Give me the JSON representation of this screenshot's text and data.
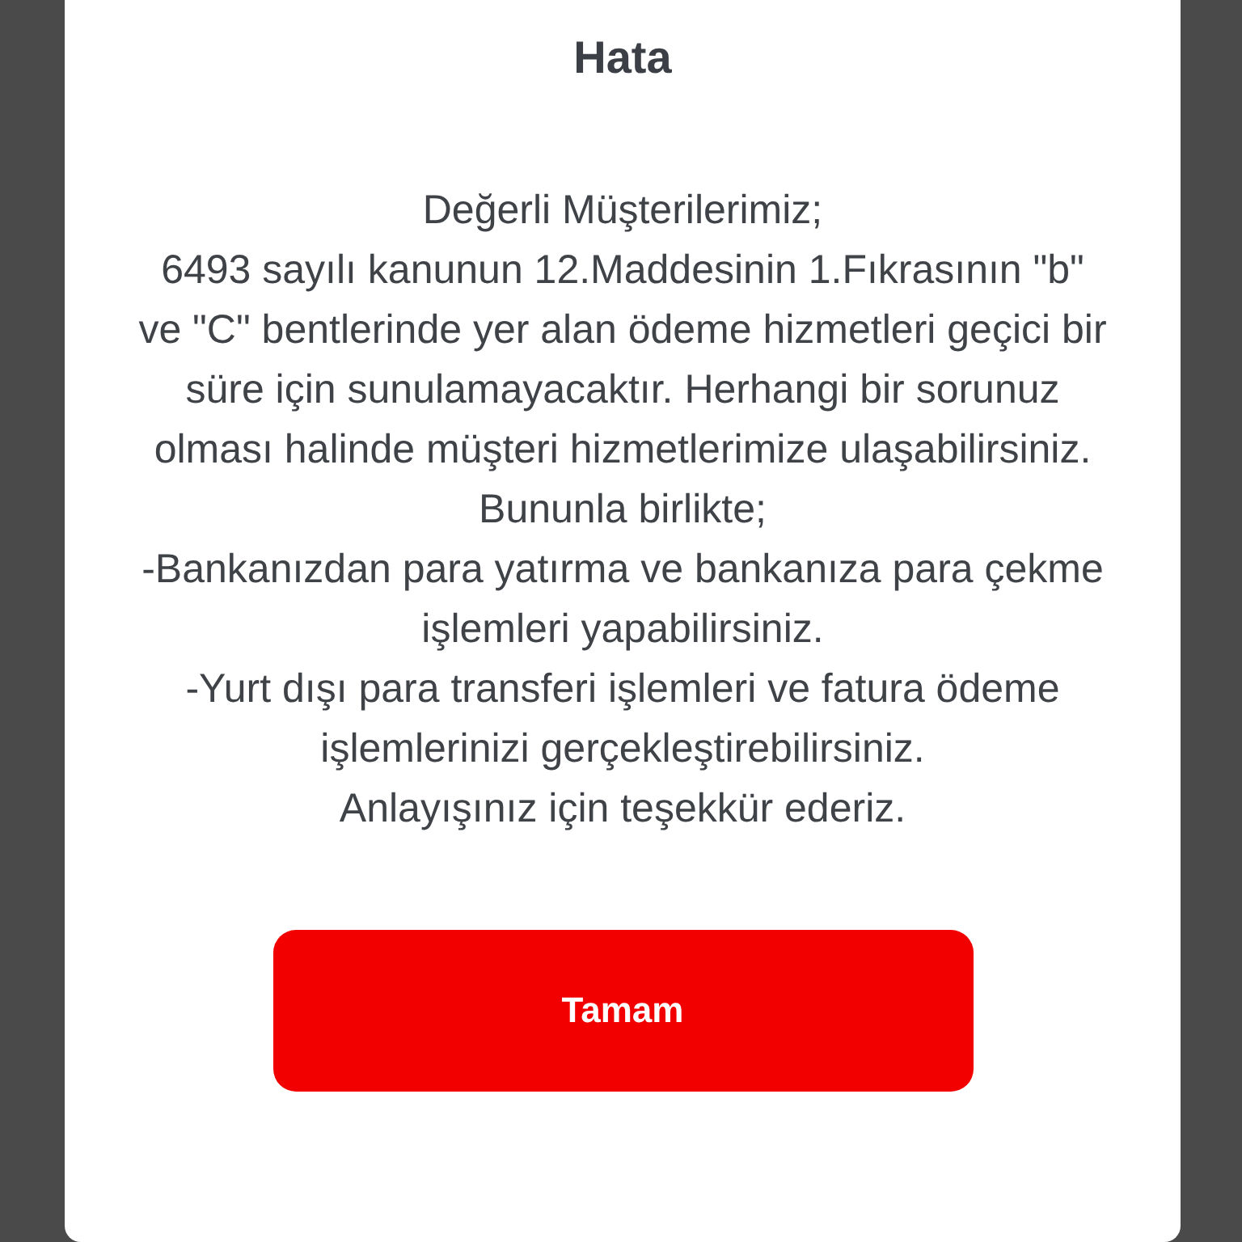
{
  "dialog": {
    "title": "Hata",
    "paragraphs": [
      "Değerli Müşterilerimiz;",
      "6493 sayılı kanunun 12.Maddesinin 1.Fıkrasının \"b\" ve \"C\" bentlerinde yer alan ödeme hizmetleri geçici bir süre için sunulamayacaktır. Herhangi bir sorunuz olması halinde müşteri hizmetlerimize ulaşabilirsiniz.",
      "Bununla birlikte;",
      "-Bankanızdan para yatırma ve bankanıza para çekme işlemleri yapabilirsiniz.",
      "-Yurt dışı para transferi işlemleri ve fatura ödeme işlemlerinizi gerçekleştirebilirsiniz.",
      "Anlayışınız için teşekkür ederiz."
    ],
    "button": "Tamam"
  }
}
